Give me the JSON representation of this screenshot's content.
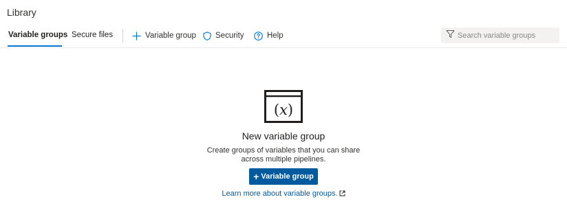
{
  "header": {
    "title": "Library"
  },
  "tabs": [
    {
      "label": "Variable groups",
      "active": true
    },
    {
      "label": "Secure files",
      "active": false
    }
  ],
  "commands": {
    "add_variable_group": {
      "label": "Variable group",
      "icon": "plus-icon"
    },
    "security": {
      "label": "Security",
      "icon": "shield-icon"
    },
    "help": {
      "label": "Help",
      "icon": "help-icon"
    }
  },
  "search": {
    "placeholder": "Search variable groups",
    "value": "",
    "icon": "filter-icon"
  },
  "empty_state": {
    "icon": "variable-group-icon",
    "title": "New variable group",
    "description": "Create groups of variables that you can share across multiple pipelines.",
    "button_label": "Variable group",
    "link_text": "Learn more about variable groups.",
    "link_icon": "external-link-icon"
  },
  "colors": {
    "accent": "#0078d4",
    "primary_button": "#005a9e",
    "link": "#005a9e"
  }
}
